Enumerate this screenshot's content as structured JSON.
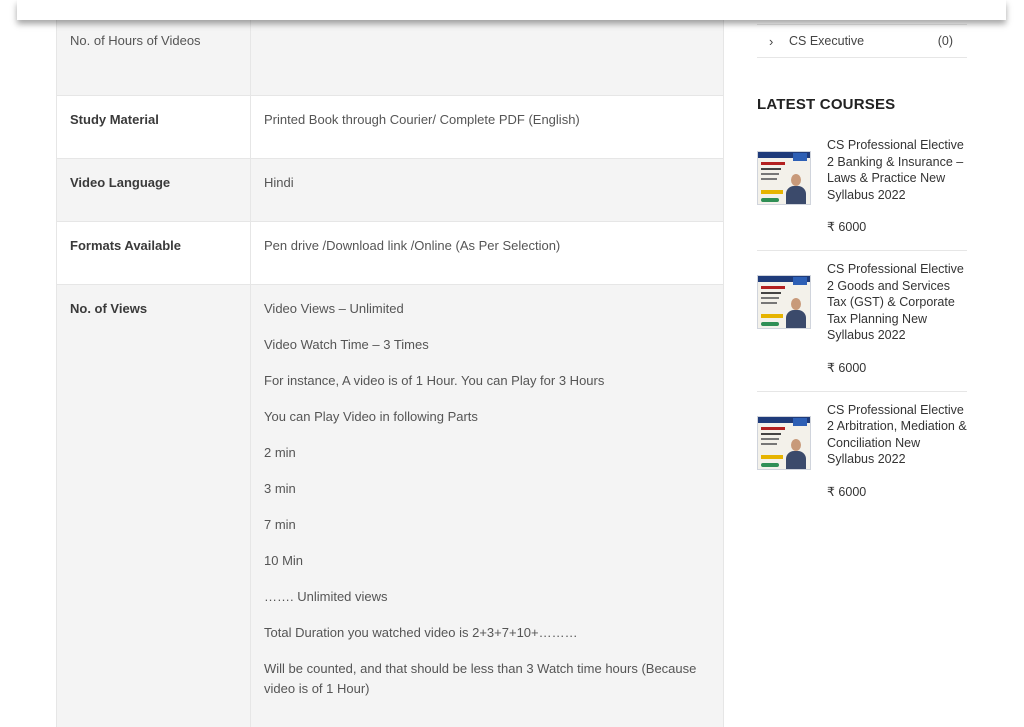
{
  "specs": {
    "rows": [
      {
        "label": "No. of Hours of Videos",
        "value": ""
      },
      {
        "label": "Study Material",
        "value": "Printed Book through Courier/ Complete PDF (English)"
      },
      {
        "label": "Video Language",
        "value": "Hindi"
      },
      {
        "label": "Formats Available",
        "value": "Pen drive /Download link /Online (As Per Selection)"
      }
    ],
    "views": {
      "label": "No. of Views",
      "lines": [
        "Video Views – Unlimited",
        "Video Watch Time – 3 Times",
        "For instance, A video is of 1 Hour. You can Play for 3 Hours",
        "You can Play Video in following Parts",
        "2 min",
        "3 min",
        "7 min",
        "10 Min",
        "……. Unlimited views",
        "Total Duration you watched video is 2+3+7+10+………",
        "Will be counted, and that should be less than 3 Watch time hours (Because video is of 1 Hour)"
      ]
    }
  },
  "sidebar": {
    "category": {
      "chevron": "›",
      "name": "CS Executive",
      "count": "(0)"
    },
    "latest_title": "LATEST COURSES",
    "courses": [
      {
        "title": "CS Professional Elective 2 Banking & Insurance – Laws & Practice New Syllabus 2022",
        "price": "₹ 6000"
      },
      {
        "title": "CS Professional Elective 2 Goods and Services Tax (GST) & Corporate Tax Planning New Syllabus 2022",
        "price": "₹ 6000"
      },
      {
        "title": "CS Professional Elective 2 Arbitration, Mediation & Conciliation New Syllabus 2022",
        "price": "₹ 6000"
      }
    ]
  }
}
